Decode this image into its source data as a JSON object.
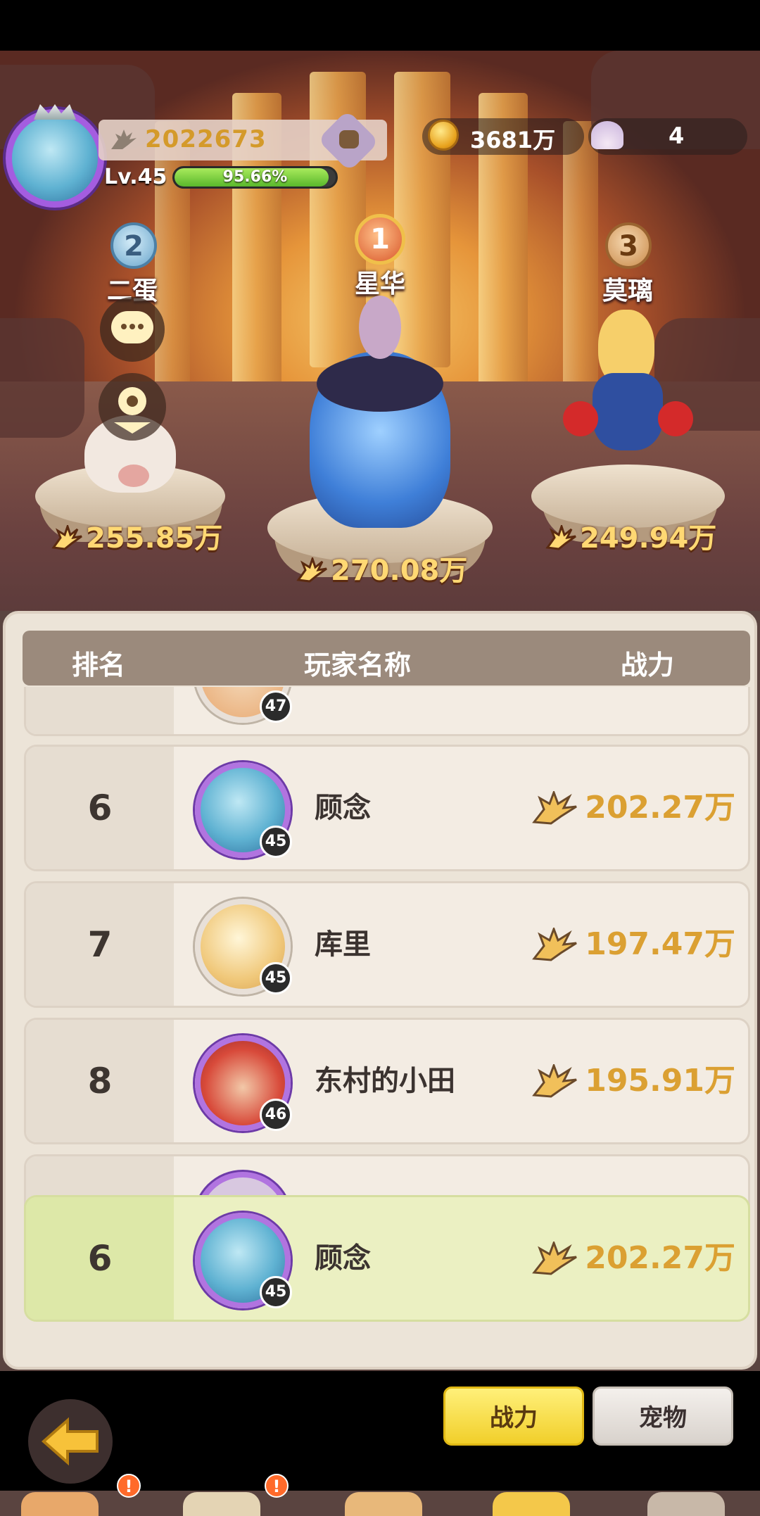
{
  "player": {
    "power": "2022673",
    "level": "Lv.45",
    "exp_percent": "95.66%",
    "exp_fraction": 0.9566
  },
  "currency": {
    "gold": "3681万",
    "shells": "4"
  },
  "podium": [
    {
      "rank": "2",
      "name": "二蛋",
      "power": "255.85万"
    },
    {
      "rank": "1",
      "name": "星华",
      "power": "270.08万"
    },
    {
      "rank": "3",
      "name": "莫璃",
      "power": "249.94万"
    }
  ],
  "table": {
    "headers": {
      "rank": "排名",
      "name": "玩家名称",
      "power": "战力"
    },
    "partial_top_level": "47",
    "rows": [
      {
        "rank": "6",
        "name": "顾念",
        "level": "45",
        "power": "202.27万"
      },
      {
        "rank": "7",
        "name": "库里",
        "level": "45",
        "power": "197.47万"
      },
      {
        "rank": "8",
        "name": "东村的小田",
        "level": "46",
        "power": "195.91万"
      }
    ],
    "my_row": {
      "rank": "6",
      "name": "顾念",
      "level": "45",
      "power": "202.27万"
    }
  },
  "tabs": {
    "power": "战力",
    "pet": "宠物"
  },
  "bottom_alerts": [
    "!",
    "!"
  ]
}
